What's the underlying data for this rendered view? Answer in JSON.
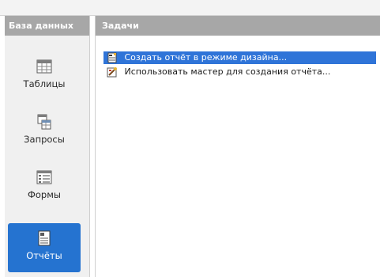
{
  "sidebar": {
    "header": "База данных",
    "items": [
      {
        "label": "Таблицы",
        "icon": "table-icon"
      },
      {
        "label": "Запросы",
        "icon": "query-icon"
      },
      {
        "label": "Формы",
        "icon": "form-icon"
      },
      {
        "label": "Отчёты",
        "icon": "report-icon",
        "active": true
      }
    ]
  },
  "main": {
    "header": "Задачи",
    "tasks": [
      {
        "label": "Создать отчёт в режиме дизайна...",
        "icon": "design-report-icon",
        "selected": true
      },
      {
        "label": "Использовать мастер для создания отчёта...",
        "icon": "wizard-icon",
        "selected": false
      }
    ]
  },
  "colors": {
    "header_bg": "#a7a7a7",
    "active_bg": "#2573d0",
    "selection_bg": "#2f74d8"
  }
}
